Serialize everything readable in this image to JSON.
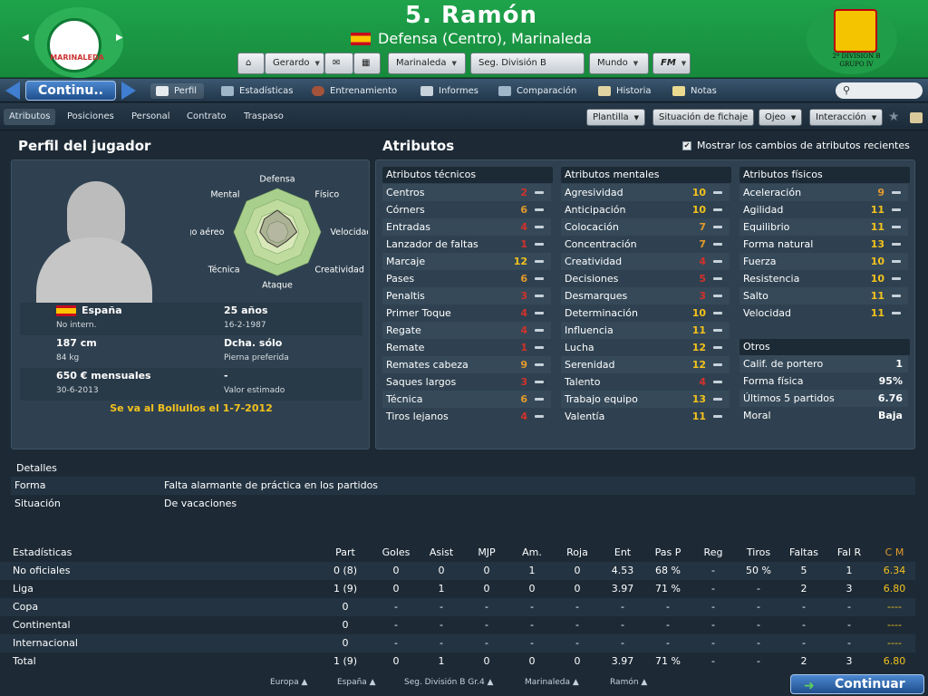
{
  "header": {
    "title": "5. Ramón",
    "subtitle": "Defensa (Centro), Marinaleda",
    "crest_text": "MARINALEDA",
    "rfef_text": "2ª DIVISION B GRUPO IV"
  },
  "toolbar": {
    "manager": "Gerardo",
    "club": "Marinaleda",
    "competition": "Seg. División B Gr.4",
    "world": "Mundo",
    "fm": "FM"
  },
  "nav": {
    "continue": "Continu..",
    "tabs": [
      "Perfil",
      "Estadísticas",
      "Entrenamiento",
      "Informes",
      "Comparación",
      "Historia",
      "Notas"
    ]
  },
  "subtabs": [
    "Atributos",
    "Posiciones",
    "Personal",
    "Contrato",
    "Traspaso"
  ],
  "actions": [
    "Plantilla",
    "Situación de fichaje",
    "Ojeo",
    "Interacción"
  ],
  "profile": {
    "heading": "Perfil del jugador",
    "radar_labels": [
      "Defensa",
      "Físico",
      "Velocidad",
      "Creatividad",
      "Ataque",
      "Técnica",
      "Juego aéreo",
      "Mental"
    ],
    "radar_values": [
      0.5,
      0.4,
      0.45,
      0.3,
      0.35,
      0.32,
      0.4,
      0.42
    ],
    "nationality": "España",
    "intl": "No intern.",
    "age": "25 años",
    "dob": "16-2-1987",
    "height": "187 cm",
    "weight": "84 kg",
    "foot": "Dcha. sólo",
    "foot_label": "Pierna preferida",
    "wage": "650 € mensuales",
    "contract_end": "30-6-2013",
    "value": "-",
    "value_label": "Valor estimado",
    "transfer_note": "Se va al Bollullos el 1-7-2012"
  },
  "attributes": {
    "heading": "Atributos",
    "show_changes": "Mostrar los cambios de atributos recientes",
    "technical": {
      "title": "Atributos técnicos",
      "items": [
        [
          "Centros",
          "2",
          "r"
        ],
        [
          "Córners",
          "6",
          "o"
        ],
        [
          "Entradas",
          "4",
          "r"
        ],
        [
          "Lanzador de faltas",
          "1",
          "r"
        ],
        [
          "Marcaje",
          "12",
          "y"
        ],
        [
          "Pases",
          "6",
          "o"
        ],
        [
          "Penaltis",
          "3",
          "r"
        ],
        [
          "Primer Toque",
          "4",
          "r"
        ],
        [
          "Regate",
          "4",
          "r"
        ],
        [
          "Remate",
          "1",
          "r"
        ],
        [
          "Remates cabeza",
          "9",
          "o"
        ],
        [
          "Saques largos",
          "3",
          "r"
        ],
        [
          "Técnica",
          "6",
          "o"
        ],
        [
          "Tiros lejanos",
          "4",
          "r"
        ]
      ]
    },
    "mental": {
      "title": "Atributos mentales",
      "items": [
        [
          "Agresividad",
          "10",
          "y"
        ],
        [
          "Anticipación",
          "10",
          "y"
        ],
        [
          "Colocación",
          "7",
          "o"
        ],
        [
          "Concentración",
          "7",
          "o"
        ],
        [
          "Creatividad",
          "4",
          "r"
        ],
        [
          "Decisiones",
          "5",
          "r"
        ],
        [
          "Desmarques",
          "3",
          "r"
        ],
        [
          "Determinación",
          "10",
          "y"
        ],
        [
          "Influencia",
          "11",
          "y"
        ],
        [
          "Lucha",
          "12",
          "y"
        ],
        [
          "Serenidad",
          "12",
          "y"
        ],
        [
          "Talento",
          "4",
          "r"
        ],
        [
          "Trabajo equipo",
          "13",
          "y"
        ],
        [
          "Valentía",
          "11",
          "y"
        ]
      ]
    },
    "physical": {
      "title": "Atributos físicos",
      "items": [
        [
          "Aceleración",
          "9",
          "o"
        ],
        [
          "Agilidad",
          "11",
          "y"
        ],
        [
          "Equilibrio",
          "11",
          "y"
        ],
        [
          "Forma natural",
          "13",
          "y"
        ],
        [
          "Fuerza",
          "10",
          "y"
        ],
        [
          "Resistencia",
          "10",
          "y"
        ],
        [
          "Salto",
          "11",
          "y"
        ],
        [
          "Velocidad",
          "11",
          "y"
        ]
      ]
    },
    "other": {
      "title": "Otros",
      "items": [
        [
          "Calif. de portero",
          "1"
        ],
        [
          "Forma física",
          "95%"
        ],
        [
          "Últimos 5 partidos",
          "6.76"
        ],
        [
          "Moral",
          "Baja"
        ]
      ]
    }
  },
  "details": {
    "heading": "Detalles",
    "rows": [
      [
        "Forma",
        "Falta alarmante de práctica en los partidos"
      ],
      [
        "Situación",
        "De vacaciones"
      ]
    ]
  },
  "stats": {
    "headers": [
      "Estadísticas",
      "Part",
      "Goles",
      "Asist",
      "MJP",
      "Am.",
      "Roja",
      "Ent",
      "Pas P",
      "Reg",
      "Tiros",
      "Faltas",
      "Fal R",
      "C M"
    ],
    "rows": [
      [
        "No oficiales",
        "0 (8)",
        "0",
        "0",
        "0",
        "1",
        "0",
        "4.53",
        "68 %",
        "-",
        "50 %",
        "5",
        "1",
        "6.34"
      ],
      [
        "Liga",
        "1 (9)",
        "0",
        "1",
        "0",
        "0",
        "0",
        "3.97",
        "71 %",
        "-",
        "-",
        "2",
        "3",
        "6.80"
      ],
      [
        "Copa",
        "0",
        "-",
        "-",
        "-",
        "-",
        "-",
        "-",
        "-",
        "-",
        "-",
        "-",
        "-",
        "----"
      ],
      [
        "Continental",
        "0",
        "-",
        "-",
        "-",
        "-",
        "-",
        "-",
        "-",
        "-",
        "-",
        "-",
        "-",
        "----"
      ],
      [
        "Internacional",
        "0",
        "-",
        "-",
        "-",
        "-",
        "-",
        "-",
        "-",
        "-",
        "-",
        "-",
        "-",
        "----"
      ],
      [
        "Total",
        "1 (9)",
        "0",
        "1",
        "0",
        "0",
        "0",
        "3.97",
        "71 %",
        "-",
        "-",
        "2",
        "3",
        "6.80"
      ]
    ]
  },
  "footer": {
    "crumbs": [
      "Europa",
      "España",
      "Seg. División B Gr.4",
      "Marinaleda",
      "Ramón"
    ],
    "continue": "Continuar"
  }
}
